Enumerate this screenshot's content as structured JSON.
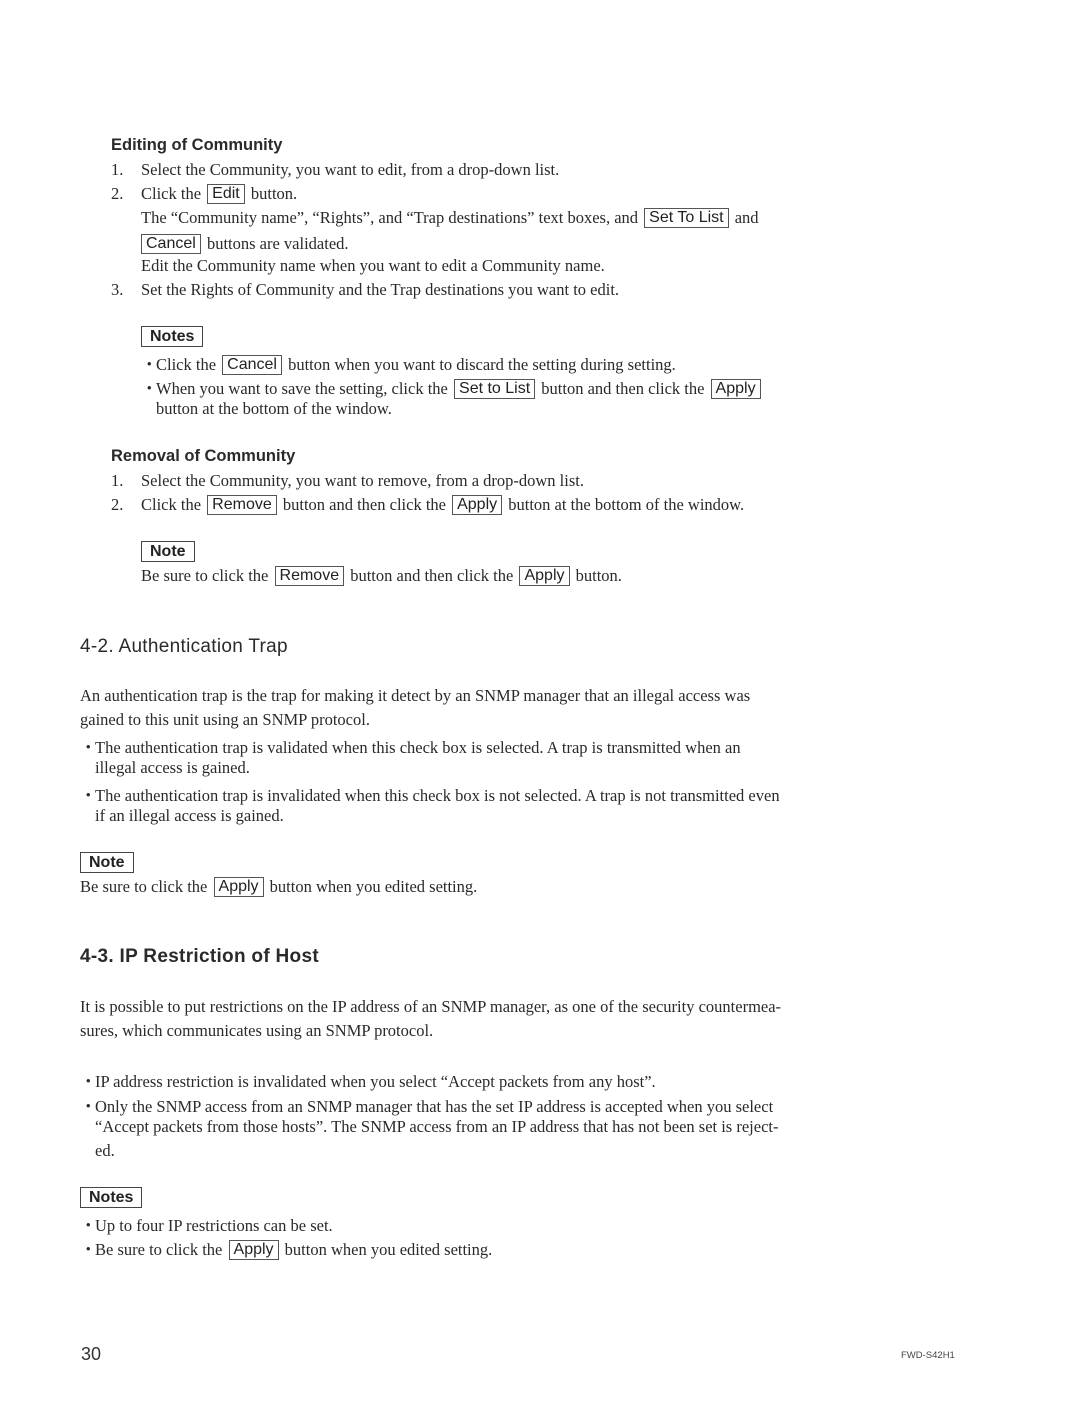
{
  "editing": {
    "heading": "Editing of Community",
    "step1_num": "1.",
    "step1": "Select the Community, you want to edit, from a drop-down list.",
    "step2_num": "2.",
    "step2_pre": "Click the",
    "step2_btn": "Edit",
    "step2_post": "button.",
    "step2_line2_pre": "The “Community name”, “Rights”, and “Trap destinations” text boxes, and",
    "step2_line2_btn": "Set To List",
    "step2_line2_post": "and",
    "step2_line3_btn": "Cancel",
    "step2_line3_post": "buttons are validated.",
    "step2_line4": "Edit the Community name when you want to edit a Community name.",
    "step3_num": "3.",
    "step3": "Set the Rights of Community and the Trap destinations you want to edit.",
    "notes_label": "Notes",
    "note1_pre": "Click the",
    "note1_btn": "Cancel",
    "note1_post": "button when you want to discard the setting during setting.",
    "note2_pre": "When you want to save the setting, click the",
    "note2_btn1": "Set to List",
    "note2_mid": "button and then click the",
    "note2_btn2": "Apply",
    "note2_line2": "button at the bottom of the window."
  },
  "removal": {
    "heading": "Removal of Community",
    "step1_num": "1.",
    "step1": "Select the Community, you want to remove, from a drop-down list.",
    "step2_num": "2.",
    "step2_pre": "Click the",
    "step2_btn1": "Remove",
    "step2_mid": "button and then click the",
    "step2_btn2": "Apply",
    "step2_post": "button at the bottom of the window.",
    "note_label": "Note",
    "note_pre": "Be sure to click the",
    "note_btn1": "Remove",
    "note_mid": "button and then click the",
    "note_btn2": "Apply",
    "note_post": "button."
  },
  "auth_trap": {
    "heading": "4-2.  Authentication Trap",
    "para_line1": "An authentication trap is the trap for making it detect by an SNMP manager that an illegal access was",
    "para_line2": "gained to this unit using an SNMP protocol.",
    "bullet1_line1": "The authentication trap is validated when this check box is selected.  A trap is transmitted when an",
    "bullet1_line2": "illegal access is gained.",
    "bullet2_line1": "The authentication trap is invalidated when this check box is not selected.  A trap is not transmitted even",
    "bullet2_line2": "if an illegal access is gained.",
    "note_label": "Note",
    "note_pre": "Be sure to click the",
    "note_btn": "Apply",
    "note_post": "button when you edited setting."
  },
  "ip_restriction": {
    "heading": "4-3.  IP Restriction of Host",
    "para_line1": "It is possible to put restrictions on the IP address of an SNMP manager, as one of the security countermea-",
    "para_line2": "sures, which communicates using an SNMP protocol.",
    "bullet1": "IP address restriction is invalidated when you select “Accept packets from any host”.",
    "bullet2_line1": "Only the SNMP access from an SNMP manager that has the set IP address is accepted when you select",
    "bullet2_line2": "“Accept packets from those hosts”.  The SNMP access from an IP address that has not been set is reject-",
    "bullet2_line3": "ed.",
    "notes_label": "Notes",
    "note1": "Up to four IP restrictions can be set.",
    "note2_pre": "Be sure to click the",
    "note2_btn": "Apply",
    "note2_post": "button when you edited setting."
  },
  "footer": {
    "page_number": "30",
    "model": "FWD-S42H1"
  },
  "bullet_char": "・"
}
